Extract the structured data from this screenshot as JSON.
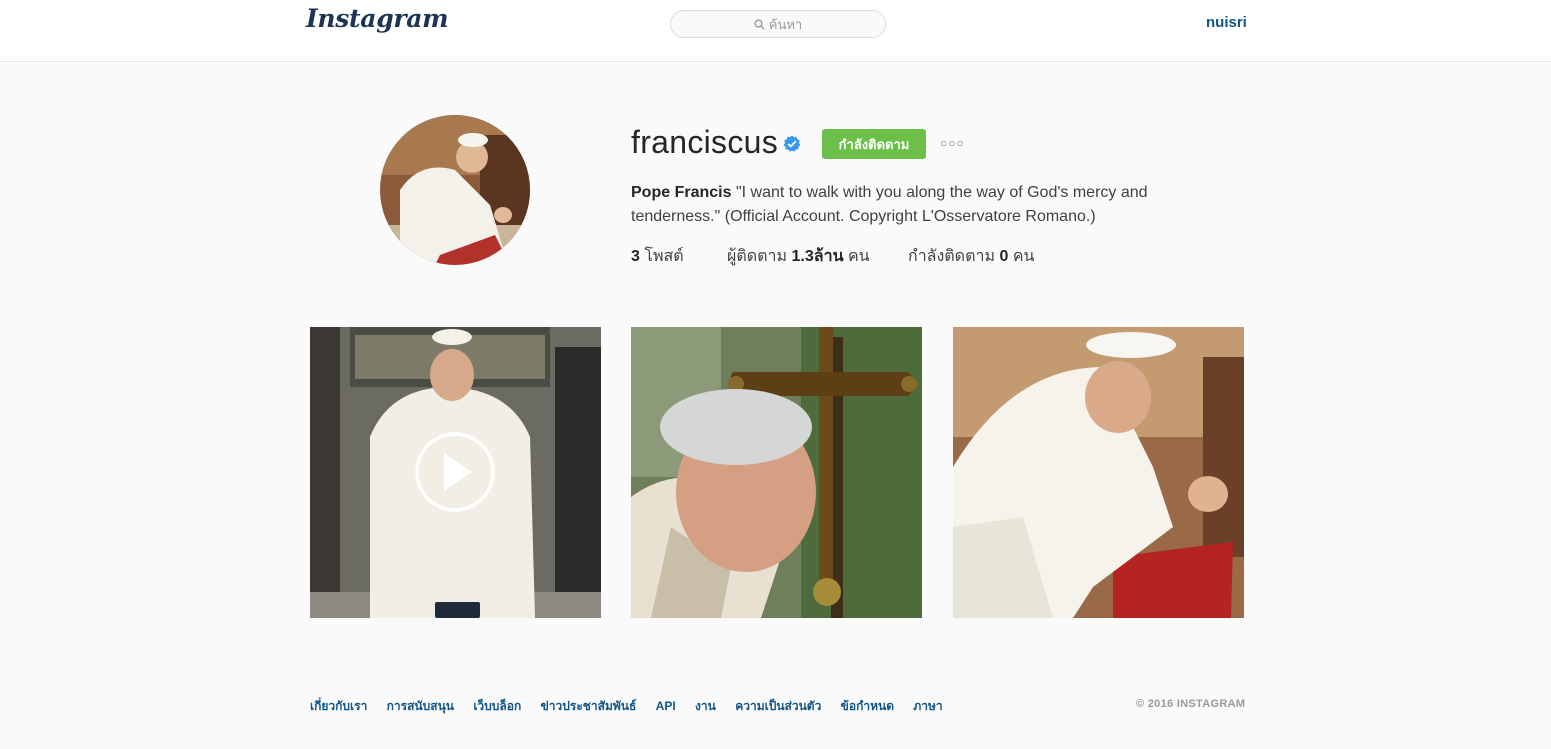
{
  "header": {
    "logo_text": "Instagram",
    "search_placeholder": "ค้นหา",
    "current_user": "nuisri"
  },
  "profile": {
    "username": "franciscus",
    "verified": true,
    "follow_button_label": "กำลังติดตาม",
    "more_options": "○○○",
    "full_name": "Pope Francis",
    "bio": "\"I want to walk with you along the way of God's mercy and tenderness.\" (Official Account. Copyright L'Osservatore Romano.)",
    "stats": {
      "posts_count": "3",
      "posts_label": "โพสต์",
      "followers_prefix": "ผู้ติดตาม",
      "followers_count": "1.3ล้าน",
      "followers_suffix": "คน",
      "following_prefix": "กำลังติดตาม",
      "following_count": "0",
      "following_suffix": "คน"
    }
  },
  "posts": [
    {
      "type": "video",
      "icon": "play-icon"
    },
    {
      "type": "photo"
    },
    {
      "type": "photo"
    }
  ],
  "footer": {
    "links": [
      "เกี่ยวกับเรา",
      "การสนับสนุน",
      "เว็บบล็อก",
      "ข่าวประชาสัมพันธ์",
      "API",
      "งาน",
      "ความเป็นส่วนตัว",
      "ข้อกำหนด",
      "ภาษา"
    ],
    "copyright": "© 2016 INSTAGRAM"
  },
  "colors": {
    "follow_button": "#6cc04a",
    "link": "#125688",
    "verified_badge": "#3897f0"
  }
}
